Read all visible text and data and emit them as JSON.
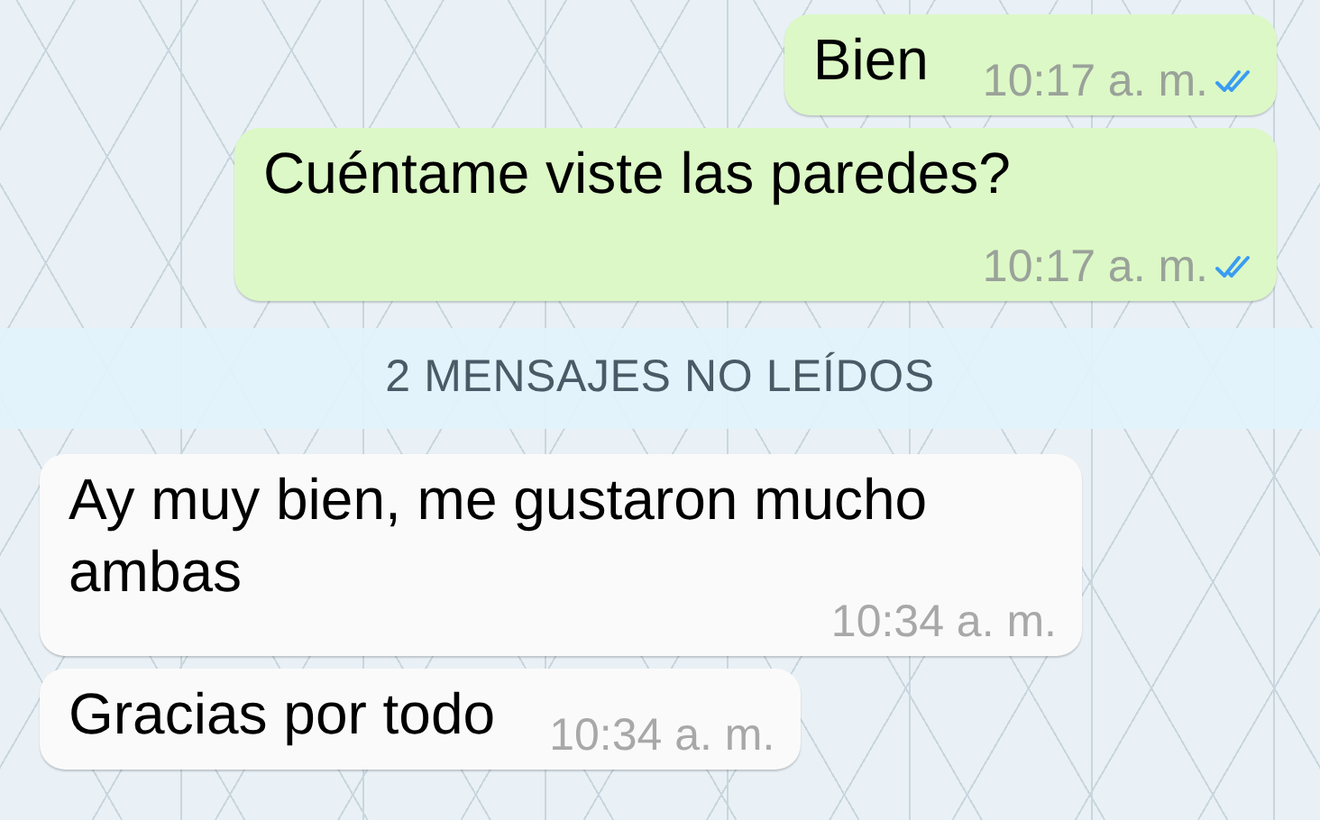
{
  "messages": [
    {
      "kind": "outgoing",
      "text": "Bien",
      "time": "10:17 a. m.",
      "read": true
    },
    {
      "kind": "outgoing",
      "text": "Cuéntame viste las paredes?",
      "time": "10:17 a. m.",
      "read": true
    },
    {
      "kind": "divider",
      "text": "2 MENSAJES NO LEÍDOS"
    },
    {
      "kind": "incoming",
      "text": "Ay muy bien, me gustaron mucho ambas",
      "time": "10:34 a. m."
    },
    {
      "kind": "incoming",
      "text": "Gracias por todo",
      "time": "10:34 a. m."
    }
  ]
}
